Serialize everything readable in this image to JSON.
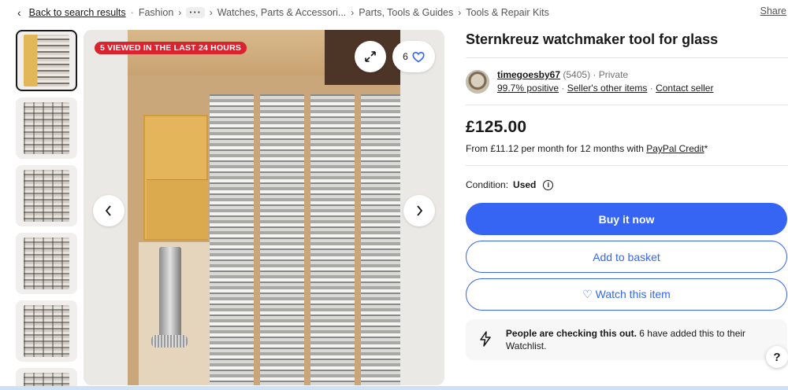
{
  "breadcrumb": {
    "back_label": "Back to search results",
    "items": [
      "Fashion",
      "Watches, Parts & Accessori...",
      "Parts, Tools & Guides",
      "Tools & Repair Kits"
    ],
    "more_label": "···"
  },
  "share_label": "Share",
  "gallery": {
    "badge": "5 VIEWED IN THE LAST 24 HOURS",
    "watch_count": "6",
    "thumbnail_count": 6
  },
  "listing": {
    "title": "Sternkreuz watchmaker tool for glass",
    "seller": {
      "name": "timegoesby67",
      "feedback_count": "(5405)",
      "type": "· Private",
      "positive": "99.7% positive",
      "other_items": "Seller's other items",
      "contact": "Contact seller"
    },
    "price": "£125.00",
    "credit_prefix": "From £11.12 per month for 12 months with",
    "credit_link": "PayPal Credit",
    "credit_suffix": "*",
    "condition_label": "Condition:",
    "condition_value": "Used"
  },
  "buttons": {
    "buy": "Buy it now",
    "basket": "Add to basket",
    "watch": "♡ Watch this item"
  },
  "notice": {
    "bold": "People are checking this out.",
    "text": " 6 have added this to their Watchlist."
  },
  "help_label": "?",
  "colors": {
    "primary": "#3665f3",
    "badge": "#d9232f"
  }
}
